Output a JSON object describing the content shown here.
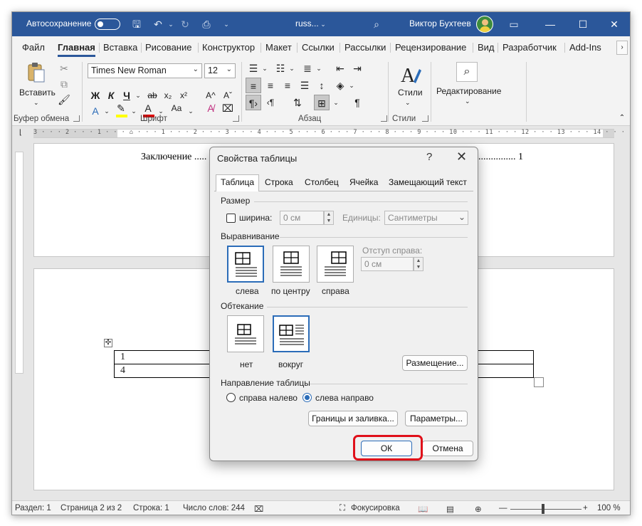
{
  "titlebar": {
    "autosave_label": "Автосохранение",
    "doc_name": "russ...",
    "user_name": "Виктор Бухтеев",
    "minimize": "—",
    "maximize": "☐",
    "close": "✕",
    "accent": "#2b579a"
  },
  "tabs": [
    "Файл",
    "Главная",
    "Вставка",
    "Рисование",
    "Конструктор",
    "Макет",
    "Ссылки",
    "Рассылки",
    "Рецензирование",
    "Вид",
    "Разработчик",
    "Add-Ins"
  ],
  "ribbon": {
    "clipboard": {
      "paste_label": "Вставить",
      "group_label": "Буфер обмена"
    },
    "font": {
      "font_name": "Times New Roman",
      "font_size": "12",
      "bold": "Ж",
      "italic": "К",
      "underline": "Ч",
      "strike": "ab",
      "subscript": "x₂",
      "superscript": "x²",
      "grow": "A^",
      "shrink": "Aˇ",
      "clear": "A",
      "case": "Aa",
      "group_label": "Шрифт"
    },
    "paragraph": {
      "group_label": "Абзац",
      "pilcrow": "¶"
    },
    "styles": {
      "label": "Стили",
      "group_label": "Стили"
    },
    "editing": {
      "label": "Редактирование"
    }
  },
  "ruler": {
    "numbers": "3 · · · 2 · · · 1 · · · ⌂ · · · 1 · · · 2 · · · 3 · · · 4 · · · 5 · · · 6 · · · 7 · · · 8 · · · 9 · · · 10 · · · 11 · · · 12 · · · 13 · · · 14 · · · 15 · · · 16 · · · 17 · · · 18 ·"
  },
  "document": {
    "toc_left": "Заключение .....",
    "toc_right": "............... 1",
    "table_rows": [
      [
        "1"
      ],
      [
        "4"
      ]
    ]
  },
  "status": {
    "section": "Раздел: 1",
    "page": "Страница 2 из 2",
    "line": "Строка: 1",
    "words": "Число слов: 244",
    "focus": "Фокусировка",
    "zoom_minus": "—",
    "zoom_plus": "+",
    "zoom": "100 %"
  },
  "dialog": {
    "title": "Свойства таблицы",
    "help": "?",
    "close": "✕",
    "tabs": [
      "Таблица",
      "Строка",
      "Столбец",
      "Ячейка",
      "Замещающий текст"
    ],
    "size": {
      "section": "Размер",
      "width_label": "ширина:",
      "width_value": "0 см",
      "units_label": "Единицы:",
      "units_value": "Сантиметры"
    },
    "alignment": {
      "section": "Выравнивание",
      "left": "слева",
      "center": "по центру",
      "right": "справа",
      "indent_label": "Отступ справа:",
      "indent_value": "0 см"
    },
    "wrapping": {
      "section": "Обтекание",
      "none": "нет",
      "around": "вокруг",
      "positioning": "Размещение..."
    },
    "direction": {
      "section": "Направление таблицы",
      "rtl": "справа налево",
      "ltr": "слева направо"
    },
    "borders_button": "Границы и заливка...",
    "options_button": "Параметры...",
    "ok": "ОК",
    "cancel": "Отмена",
    "highlight_color": "#e0101a"
  }
}
